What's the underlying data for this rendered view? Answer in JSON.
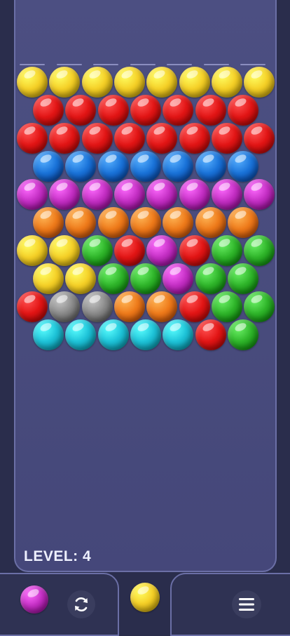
{
  "level": {
    "label": "LEVEL: 4"
  },
  "colors": {
    "yellow": "#f5d027",
    "red": "#e21515",
    "blue": "#1a73d9",
    "magenta": "#c42fc4",
    "orange": "#ee7a1a",
    "green": "#2fb52a",
    "gray": "#8a8a8a",
    "cyan": "#1ec3d8"
  },
  "grid": {
    "rows": [
      [
        "yellow",
        "yellow",
        "yellow",
        "yellow",
        "yellow",
        "yellow",
        "yellow",
        "yellow"
      ],
      [
        "red",
        "red",
        "red",
        "red",
        "red",
        "red",
        "red"
      ],
      [
        "red",
        "red",
        "red",
        "red",
        "red",
        "red",
        "red",
        "red"
      ],
      [
        "blue",
        "blue",
        "blue",
        "blue",
        "blue",
        "blue",
        "blue"
      ],
      [
        "magenta",
        "magenta",
        "magenta",
        "magenta",
        "magenta",
        "magenta",
        "magenta",
        "magenta"
      ],
      [
        "orange",
        "orange",
        "orange",
        "orange",
        "orange",
        "orange",
        "orange"
      ],
      [
        "yellow",
        "yellow",
        "green",
        "red",
        "magenta",
        "red",
        "green",
        "green"
      ],
      [
        "yellow",
        "yellow",
        "green",
        "green",
        "magenta",
        "green",
        "green"
      ],
      [
        "red",
        "gray",
        "gray",
        "orange",
        "orange",
        "red",
        "green",
        "green"
      ],
      [
        "cyan",
        "cyan",
        "cyan",
        "cyan",
        "cyan",
        "red",
        "green"
      ]
    ]
  },
  "shooter": {
    "current": "yellow",
    "next": "magenta"
  },
  "icons": {
    "swap": "swap-refresh-icon",
    "menu": "hamburger-menu-icon"
  }
}
